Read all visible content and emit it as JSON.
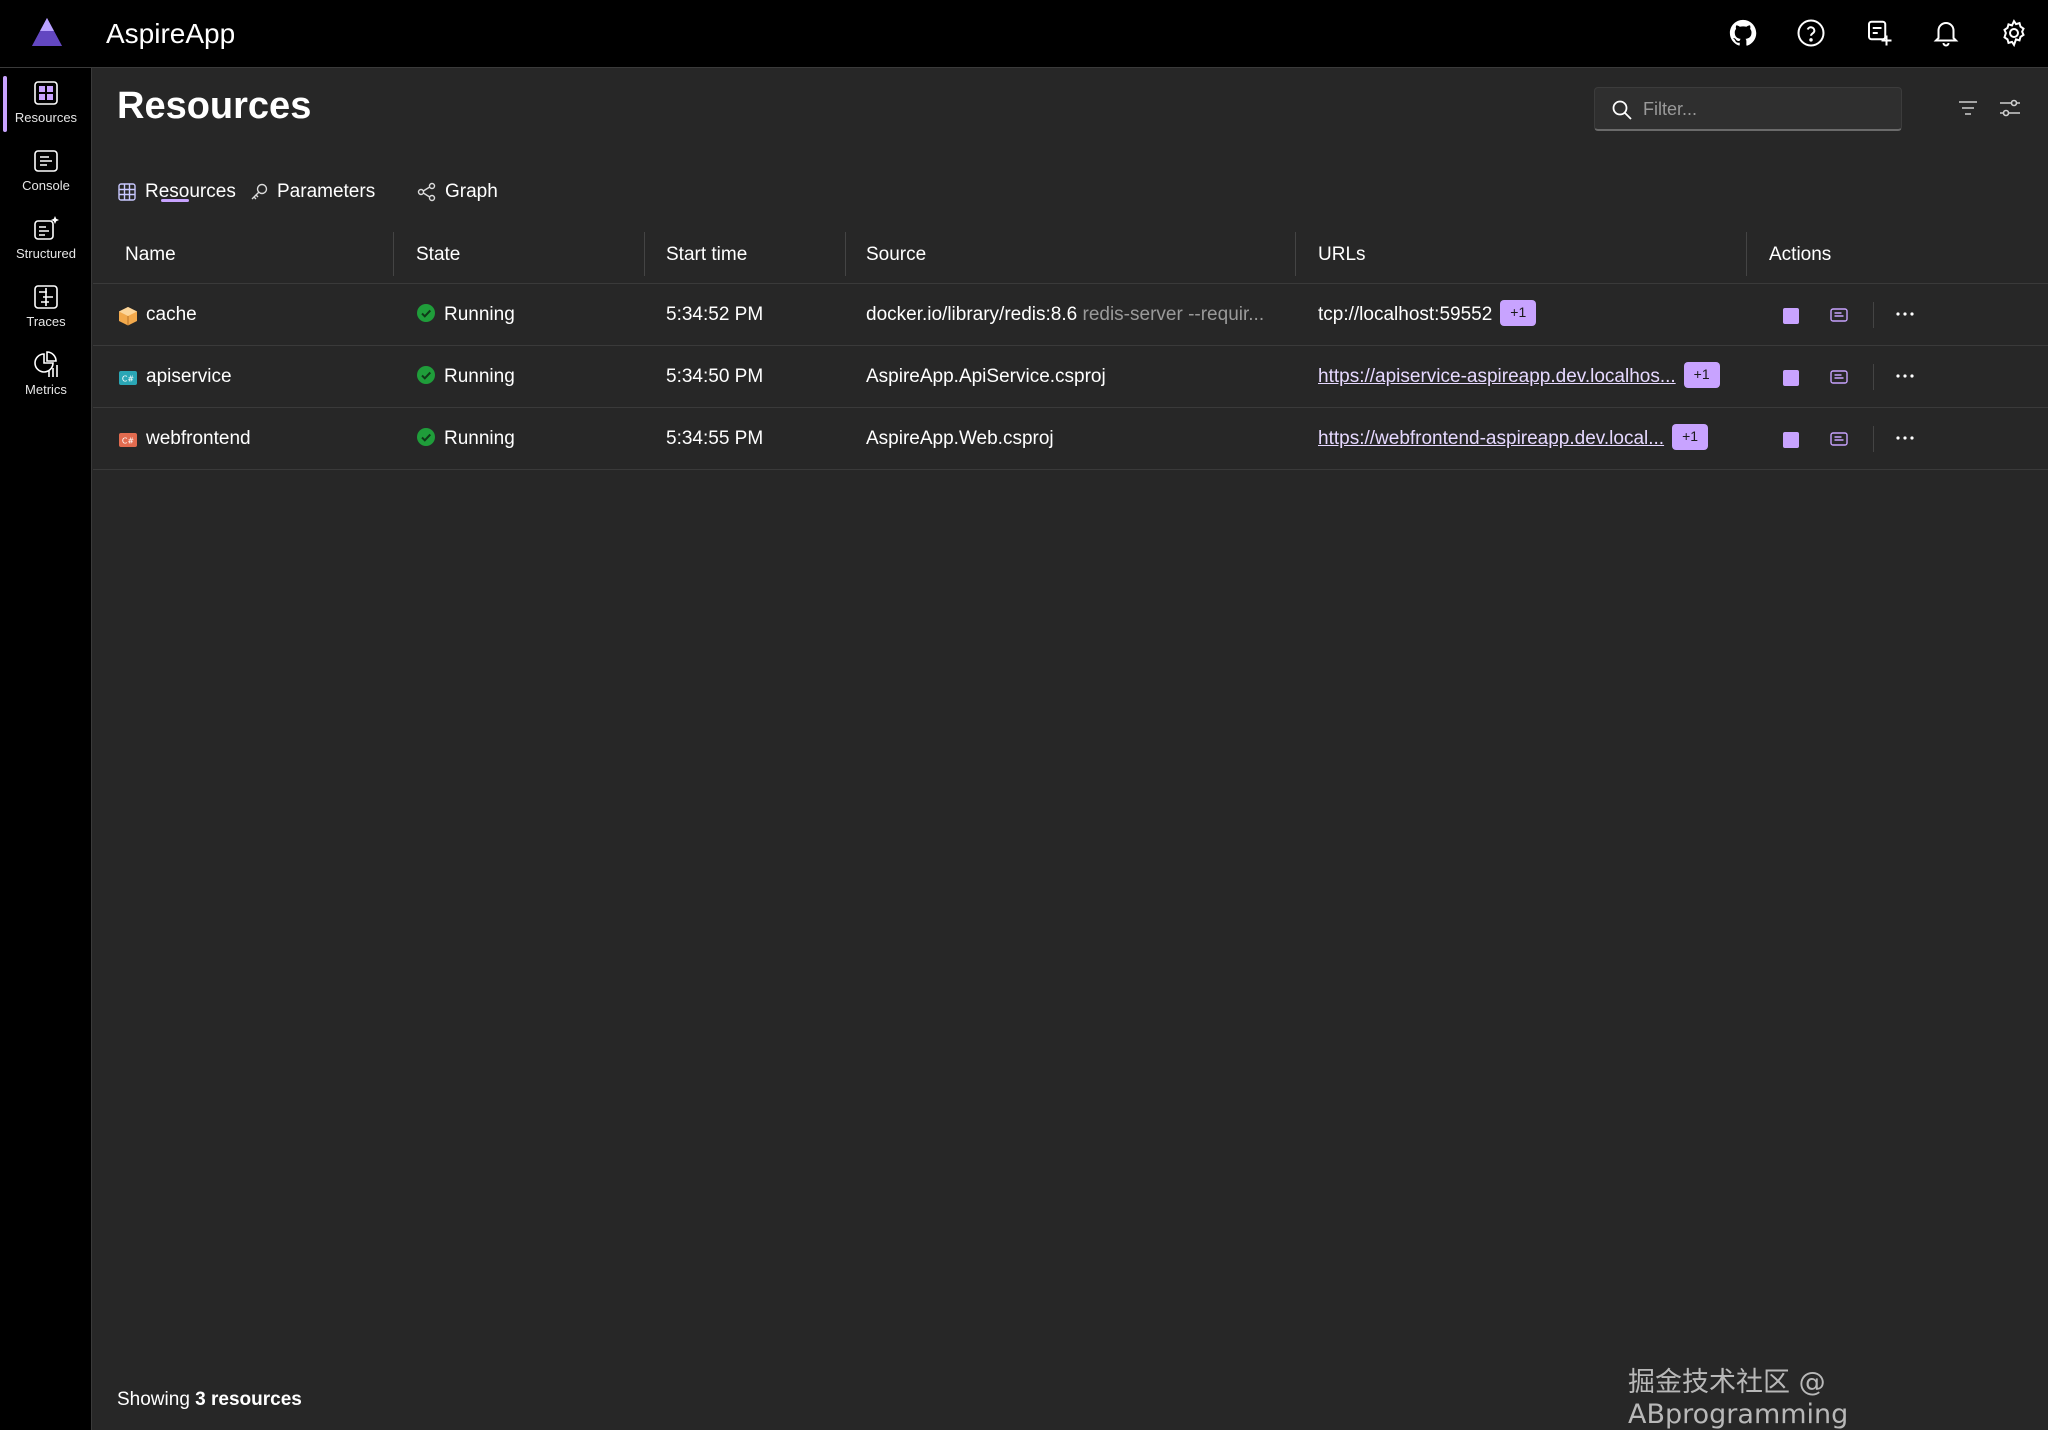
{
  "app": {
    "title": "AspireApp"
  },
  "topbar": {
    "icons": [
      "github-icon",
      "help-icon",
      "launch-icon",
      "notifications-icon",
      "settings-icon"
    ]
  },
  "nav": {
    "items": [
      {
        "label": "Resources",
        "icon": "resources-icon",
        "active": true
      },
      {
        "label": "Console",
        "icon": "console-icon"
      },
      {
        "label": "Structured",
        "icon": "structured-icon"
      },
      {
        "label": "Traces",
        "icon": "traces-icon"
      },
      {
        "label": "Metrics",
        "icon": "metrics-icon"
      }
    ]
  },
  "page": {
    "title": "Resources",
    "filter_placeholder": "Filter..."
  },
  "tabs": [
    {
      "label": "Resources",
      "icon": "grid-icon",
      "active": true
    },
    {
      "label": "Parameters",
      "icon": "key-icon"
    },
    {
      "label": "Graph",
      "icon": "graph-icon"
    }
  ],
  "table": {
    "columns": [
      "Name",
      "State",
      "Start time",
      "Source",
      "URLs",
      "Actions"
    ],
    "rows": [
      {
        "name": "cache",
        "type_icon": "container-icon",
        "state": "Running",
        "start_time": "5:34:52 PM",
        "source": "docker.io/library/redis:8.6",
        "source_args": "redis-server --requir...",
        "url": "tcp://localhost:59552",
        "url_is_link": false,
        "url_more": "+1"
      },
      {
        "name": "apiservice",
        "type_icon": "project-icon",
        "state": "Running",
        "start_time": "5:34:50 PM",
        "source": "AspireApp.ApiService.csproj",
        "source_args": "",
        "url": "https://apiservice-aspireapp.dev.localhos...",
        "url_is_link": true,
        "url_more": "+1"
      },
      {
        "name": "webfrontend",
        "type_icon": "project-icon",
        "state": "Running",
        "start_time": "5:34:55 PM",
        "source": "AspireApp.Web.csproj",
        "source_args": "",
        "url": "https://webfrontend-aspireapp.dev.local...",
        "url_is_link": true,
        "url_more": "+1"
      }
    ]
  },
  "footer": {
    "prefix": "Showing ",
    "count": "3 resources"
  },
  "watermark": "掘金技术社区 @ ABprogramming",
  "colors": {
    "accent": "#c8a3ff",
    "running": "#1f9d3a",
    "background": "#272727",
    "chrome": "#000000"
  }
}
